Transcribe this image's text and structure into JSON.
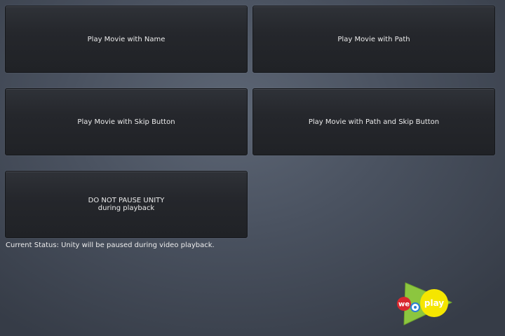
{
  "buttons": {
    "play_with_name": "Play Movie with Name",
    "play_with_path": "Play Movie with Path",
    "play_with_skip": "Play Movie with Skip Button",
    "play_with_path_and_skip": "Play Movie with Path and Skip Button",
    "do_not_pause_line1": "DO NOT PAUSE UNITY",
    "do_not_pause_line2": "during playback"
  },
  "status": {
    "text": "Current Status: Unity will be paused during video playback."
  },
  "logo": {
    "icon": "weplay-logo-icon",
    "word_we": "we",
    "word_play": "play"
  },
  "colors": {
    "logo_green": "#8cc63f",
    "logo_yellow": "#f5e600",
    "logo_red": "#d9282f",
    "logo_blue": "#2a7fd4"
  }
}
